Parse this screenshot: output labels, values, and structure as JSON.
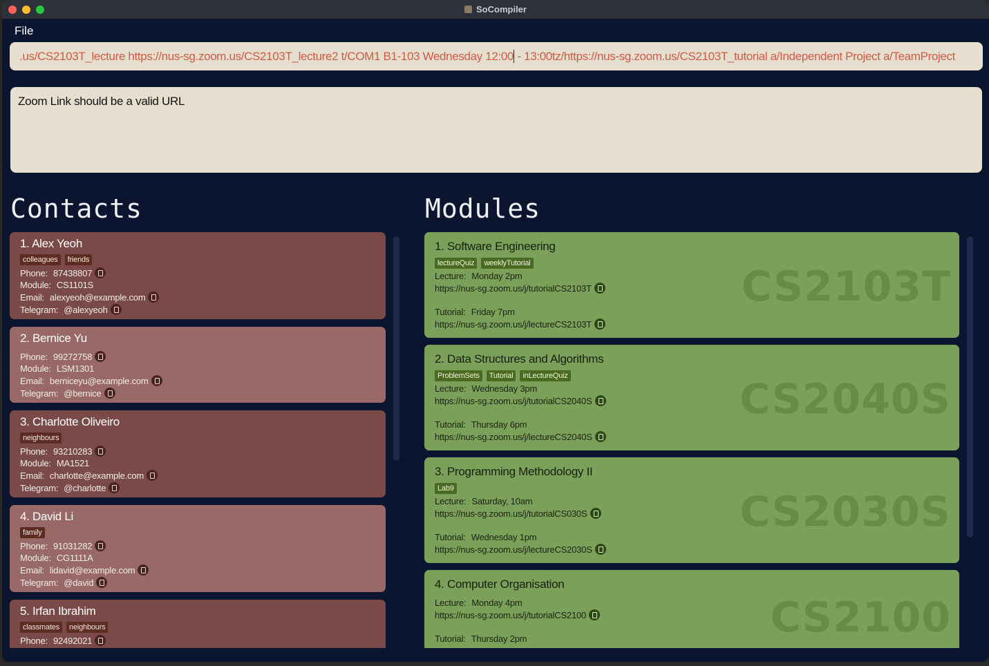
{
  "window": {
    "title": "SoCompiler"
  },
  "menu": {
    "file": "File"
  },
  "command": {
    "value": ".us/CS2103T_lecture https://nus-sg.zoom.us/CS2103T_lecture2 t/COM1 B1-103 Wednesday 12:00",
    "value_after_caret": " - 13:00tz/https://nus-sg.zoom.us/CS2103T_tutorial a/Independent Project a/TeamProject"
  },
  "result": {
    "message": "Zoom Link should be a valid URL"
  },
  "contacts": {
    "title": "Contacts",
    "phone_label": "Phone:",
    "module_label": "Module:",
    "email_label": "Email:",
    "telegram_label": "Telegram:",
    "items": [
      {
        "name": "1.  Alex Yeoh",
        "tags": [
          "colleagues",
          "friends"
        ],
        "phone": "87438807",
        "module": "CS1101S",
        "email": "alexyeoh@example.com",
        "telegram": "@alexyeoh"
      },
      {
        "name": "2.  Bernice Yu",
        "tags": [],
        "phone": "99272758",
        "module": "LSM1301",
        "email": "berniceyu@example.com",
        "telegram": "@bernice"
      },
      {
        "name": "3.  Charlotte Oliveiro",
        "tags": [
          "neighbours"
        ],
        "phone": "93210283",
        "module": "MA1521",
        "email": "charlotte@example.com",
        "telegram": "@charlotte"
      },
      {
        "name": "4.  David Li",
        "tags": [
          "family"
        ],
        "phone": "91031282",
        "module": "CG1111A",
        "email": "lidavid@example.com",
        "telegram": "@david"
      },
      {
        "name": "5.  Irfan Ibrahim",
        "tags": [
          "classmates",
          "neighbours"
        ],
        "phone": "92492021"
      }
    ]
  },
  "modules": {
    "title": "Modules",
    "lecture_label": "Lecture:",
    "tutorial_label": "Tutorial:",
    "items": [
      {
        "name": "1.  Software Engineering",
        "code": "CS2103T",
        "tags": [
          "lectureQuiz",
          "weeklyTutorial"
        ],
        "lecture_time": "Monday 2pm",
        "lecture_link": "https://nus-sg.zoom.us/j/tutorialCS2103T",
        "tutorial_time": "Friday 7pm",
        "tutorial_link": "https://nus-sg.zoom.us/j/lectureCS2103T"
      },
      {
        "name": "2.  Data Structures and Algorithms",
        "code": "CS2040S",
        "tags": [
          "ProblemSets",
          "Tutorial",
          "inLectureQuiz"
        ],
        "lecture_time": "Wednesday 3pm",
        "lecture_link": "https://nus-sg.zoom.us/j/tutorialCS2040S",
        "tutorial_time": "Thursday 6pm",
        "tutorial_link": "https://nus-sg.zoom.us/j/lectureCS2040S"
      },
      {
        "name": "3.  Programming Methodology II",
        "code": "CS2030S",
        "tags": [
          "Lab9"
        ],
        "lecture_time": "Saturday, 10am",
        "lecture_link": "https://nus-sg.zoom.us/j/tutorialCS030S",
        "tutorial_time": "Wednesday 1pm",
        "tutorial_link": "https://nus-sg.zoom.us/j/lectureCS2030S"
      },
      {
        "name": "4.  Computer Organisation",
        "code": "CS2100",
        "tags": [],
        "lecture_time": "Monday 4pm",
        "lecture_link": "https://nus-sg.zoom.us/j/tutorialCS2100",
        "tutorial_time": "Thursday 2pm"
      }
    ]
  },
  "colors": {
    "background": "#0c1530",
    "input_bg": "#e6dfcf",
    "command_text": "#d05a45",
    "contact_card_dark": "#7a4a48",
    "contact_card_light": "#986966",
    "module_card": "#7ba05a"
  }
}
